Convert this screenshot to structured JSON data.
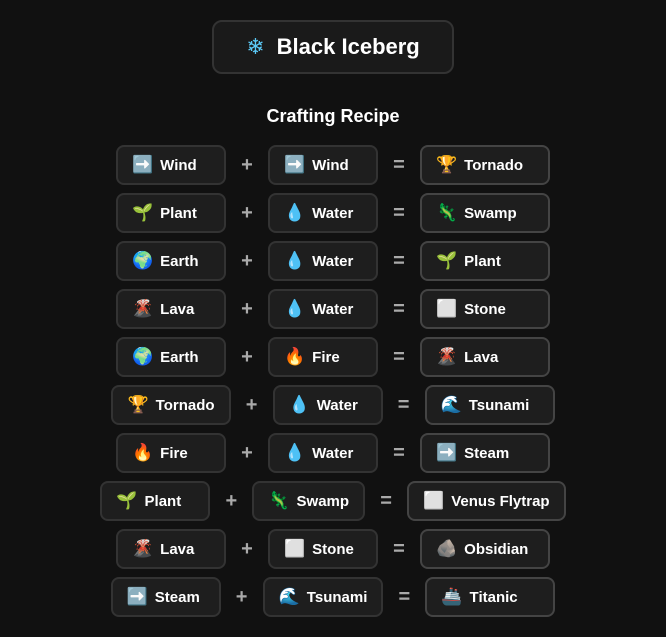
{
  "header": {
    "icon": "❄",
    "title": "Black Iceberg"
  },
  "section_label": "Crafting Recipe",
  "recipes": [
    {
      "id": 1,
      "ing1_icon": "➡️",
      "ing1_label": "Wind",
      "ing2_icon": "➡️",
      "ing2_label": "Wind",
      "result_icon": "🏆",
      "result_label": "Tornado"
    },
    {
      "id": 2,
      "ing1_icon": "🌱",
      "ing1_label": "Plant",
      "ing2_icon": "💧",
      "ing2_label": "Water",
      "result_icon": "🦎",
      "result_label": "Swamp"
    },
    {
      "id": 3,
      "ing1_icon": "🌍",
      "ing1_label": "Earth",
      "ing2_icon": "💧",
      "ing2_label": "Water",
      "result_icon": "🌱",
      "result_label": "Plant"
    },
    {
      "id": 4,
      "ing1_icon": "🌋",
      "ing1_label": "Lava",
      "ing2_icon": "💧",
      "ing2_label": "Water",
      "result_icon": "⬜",
      "result_label": "Stone"
    },
    {
      "id": 5,
      "ing1_icon": "🌍",
      "ing1_label": "Earth",
      "ing2_icon": "🔥",
      "ing2_label": "Fire",
      "result_icon": "🌋",
      "result_label": "Lava"
    },
    {
      "id": 6,
      "ing1_icon": "🏆",
      "ing1_label": "Tornado",
      "ing2_icon": "💧",
      "ing2_label": "Water",
      "result_icon": "🌊",
      "result_label": "Tsunami"
    },
    {
      "id": 7,
      "ing1_icon": "🔥",
      "ing1_label": "Fire",
      "ing2_icon": "💧",
      "ing2_label": "Water",
      "result_icon": "➡️",
      "result_label": "Steam"
    },
    {
      "id": 8,
      "ing1_icon": "🌱",
      "ing1_label": "Plant",
      "ing2_icon": "🦎",
      "ing2_label": "Swamp",
      "result_icon": "⬜",
      "result_label": "Venus Flytrap"
    },
    {
      "id": 9,
      "ing1_icon": "🌋",
      "ing1_label": "Lava",
      "ing2_icon": "⬜",
      "ing2_label": "Stone",
      "result_icon": "🪨",
      "result_label": "Obsidian"
    },
    {
      "id": 10,
      "ing1_icon": "➡️",
      "ing1_label": "Steam",
      "ing2_icon": "🌊",
      "ing2_label": "Tsunami",
      "result_icon": "🚢",
      "result_label": "Titanic"
    }
  ]
}
